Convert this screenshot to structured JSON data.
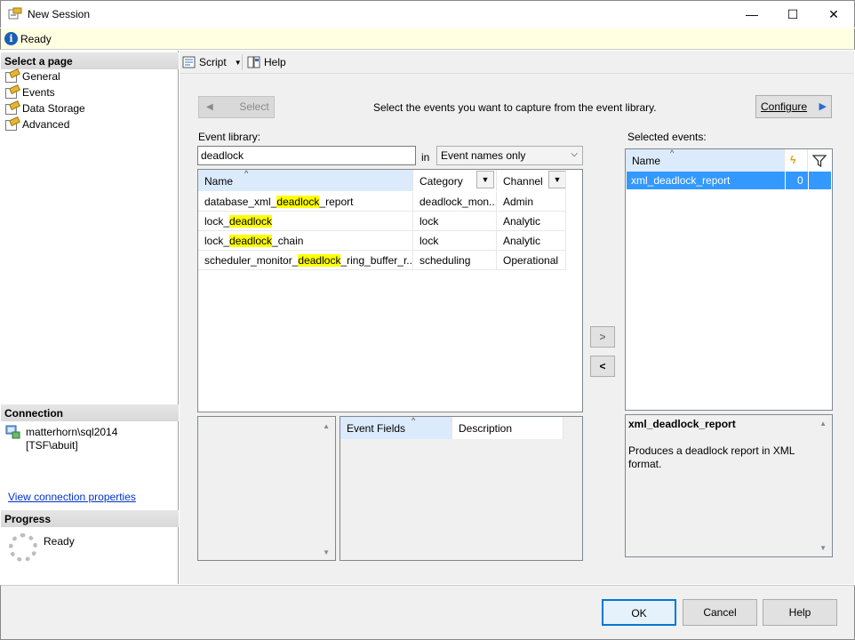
{
  "window": {
    "title": "New Session",
    "minimize": "—",
    "maximize": "☐",
    "close": "✕"
  },
  "status": {
    "text": "Ready"
  },
  "left": {
    "select_page_header": "Select a page",
    "pages": [
      {
        "label": "General"
      },
      {
        "label": "Events"
      },
      {
        "label": "Data Storage"
      },
      {
        "label": "Advanced"
      }
    ],
    "connection_header": "Connection",
    "connection_server": "matterhorn\\sql2014",
    "connection_user": "[TSF\\abuit]",
    "view_connection_link": "View connection properties",
    "progress_header": "Progress",
    "progress_status": "Ready"
  },
  "toolbar": {
    "script_label": "Script",
    "help_label": "Help"
  },
  "events": {
    "select_button": "Select",
    "instruction": "Select the events you want to capture from the event library.",
    "configure_button": "Configure",
    "library_label": "Event library:",
    "search_value": "deadlock",
    "in_label": "in",
    "search_scope": "Event names only",
    "library_columns": {
      "name": "Name",
      "category": "Category",
      "channel": "Channel"
    },
    "library_rows": [
      {
        "name_pre": "database_xml_",
        "name_hl": "deadlock",
        "name_post": "_report",
        "category": "deadlock_mon...",
        "channel": "Admin"
      },
      {
        "name_pre": "lock_",
        "name_hl": "deadlock",
        "name_post": "",
        "category": "lock",
        "channel": "Analytic"
      },
      {
        "name_pre": "lock_",
        "name_hl": "deadlock",
        "name_post": "_chain",
        "category": "lock",
        "channel": "Analytic"
      },
      {
        "name_pre": "scheduler_monitor_",
        "name_hl": "deadlock",
        "name_post": "_ring_buffer_r...",
        "category": "scheduling",
        "channel": "Operational"
      }
    ],
    "add_arrow": ">",
    "remove_arrow": "<",
    "selected_label": "Selected events:",
    "selected_columns": {
      "name": "Name"
    },
    "selected_rows": [
      {
        "name": "xml_deadlock_report",
        "count": "0"
      }
    ],
    "fields_columns": {
      "event_fields": "Event Fields",
      "description": "Description"
    },
    "detail_title": "xml_deadlock_report",
    "detail_text": "Produces a deadlock report in XML format."
  },
  "buttons": {
    "ok": "OK",
    "cancel": "Cancel",
    "help": "Help"
  },
  "colors": {
    "selection": "#3399ff",
    "highlight": "#ffff00",
    "status_bg": "#ffffe1",
    "sorted_header": "#dcebfc"
  }
}
